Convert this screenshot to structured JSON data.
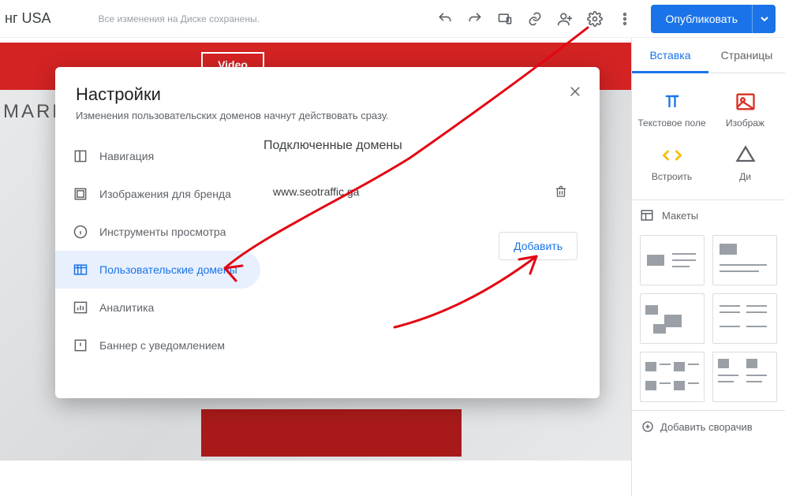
{
  "topbar": {
    "doc_title": "нг USA",
    "save_status": "Все изменения на Диске сохранены.",
    "publish_label": "Опубликовать"
  },
  "canvas": {
    "video_label": "Video",
    "mark_text": "MARK"
  },
  "side": {
    "tabs": {
      "insert": "Вставка",
      "pages": "Страницы"
    },
    "tools": {
      "text": "Текстовое поле",
      "image": "Изображ",
      "embed": "Встроить",
      "drive": "Ди"
    },
    "layouts_label": "Макеты",
    "collapse_label": "Добавить сворачив"
  },
  "settings": {
    "title": "Настройки",
    "subtitle": "Изменения пользовательских доменов начнут действовать сразу.",
    "nav": {
      "navigation": "Навигация",
      "brand": "Изображения для бренда",
      "viewer": "Инструменты просмотра",
      "domains": "Пользовательские домены",
      "analytics": "Аналитика",
      "banner": "Баннер с уведомлением"
    },
    "content": {
      "heading": "Подключенные домены",
      "domain0": "www.seotraffic.ga",
      "add_label": "Добавить"
    }
  }
}
